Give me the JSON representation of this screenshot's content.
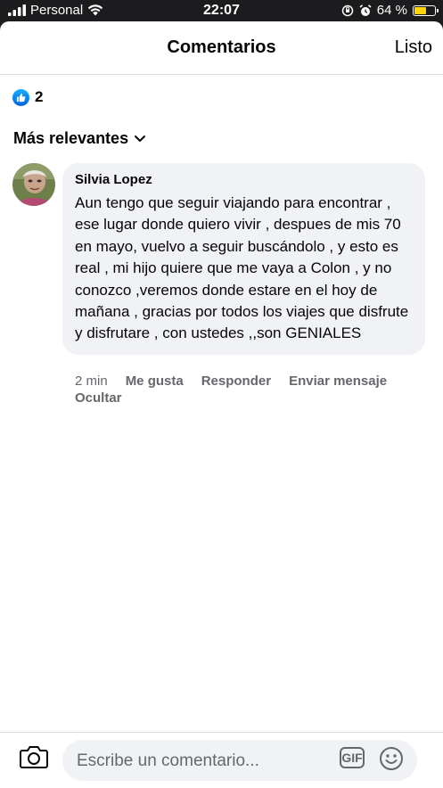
{
  "status_bar": {
    "carrier": "Personal",
    "time": "22:07",
    "battery_percent": "64 %",
    "battery_level": 0.64
  },
  "header": {
    "title": "Comentarios",
    "done_label": "Listo"
  },
  "reactions": {
    "icon": "like-icon",
    "count": "2"
  },
  "sort": {
    "label": "Más relevantes",
    "icon": "chevron-down-icon"
  },
  "comments": [
    {
      "author": "Silvia Lopez",
      "text": "Aun tengo que seguir viajando para encontrar , ese lugar donde quiero vivir , despues de mis 70 en mayo, vuelvo a seguir buscándolo , y esto es real , mi hijo quiere que me vaya a Colon , y no conozco ,veremos donde estare en el hoy de mañana , gracias por todos los viajes que disfrute y disfrutare , con ustedes ,,son GENIALES",
      "time": "2 min",
      "actions": {
        "like": "Me gusta",
        "reply": "Responder",
        "message": "Enviar mensaje",
        "hide": "Ocultar"
      }
    }
  ],
  "composer": {
    "placeholder": "Escribe un comentario...",
    "gif_label": "GIF",
    "camera_icon": "camera-icon",
    "emoji_icon": "emoji-icon"
  },
  "colors": {
    "brand_blue": "#1877f2",
    "bubble_bg": "#f0f2f5",
    "secondary_text": "#65676b",
    "battery": "#ffd60a"
  }
}
